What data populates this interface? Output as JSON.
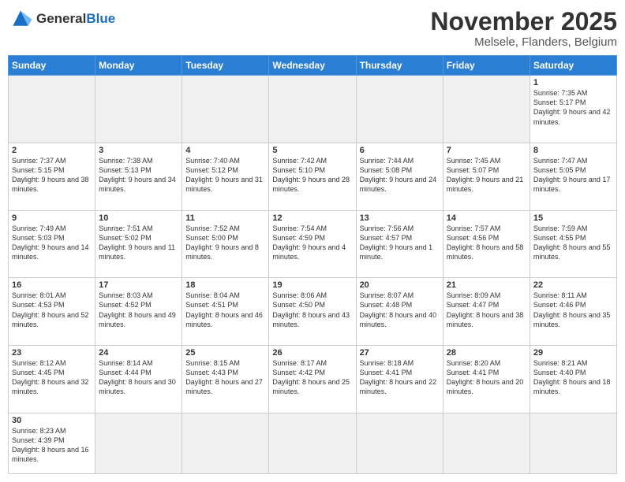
{
  "header": {
    "logo_general": "General",
    "logo_blue": "Blue",
    "month_title": "November 2025",
    "location": "Melsele, Flanders, Belgium"
  },
  "days_of_week": [
    "Sunday",
    "Monday",
    "Tuesday",
    "Wednesday",
    "Thursday",
    "Friday",
    "Saturday"
  ],
  "weeks": [
    [
      {
        "day": "",
        "info": ""
      },
      {
        "day": "",
        "info": ""
      },
      {
        "day": "",
        "info": ""
      },
      {
        "day": "",
        "info": ""
      },
      {
        "day": "",
        "info": ""
      },
      {
        "day": "",
        "info": ""
      },
      {
        "day": "1",
        "info": "Sunrise: 7:35 AM\nSunset: 5:17 PM\nDaylight: 9 hours and 42 minutes."
      }
    ],
    [
      {
        "day": "2",
        "info": "Sunrise: 7:37 AM\nSunset: 5:15 PM\nDaylight: 9 hours and 38 minutes."
      },
      {
        "day": "3",
        "info": "Sunrise: 7:38 AM\nSunset: 5:13 PM\nDaylight: 9 hours and 34 minutes."
      },
      {
        "day": "4",
        "info": "Sunrise: 7:40 AM\nSunset: 5:12 PM\nDaylight: 9 hours and 31 minutes."
      },
      {
        "day": "5",
        "info": "Sunrise: 7:42 AM\nSunset: 5:10 PM\nDaylight: 9 hours and 28 minutes."
      },
      {
        "day": "6",
        "info": "Sunrise: 7:44 AM\nSunset: 5:08 PM\nDaylight: 9 hours and 24 minutes."
      },
      {
        "day": "7",
        "info": "Sunrise: 7:45 AM\nSunset: 5:07 PM\nDaylight: 9 hours and 21 minutes."
      },
      {
        "day": "8",
        "info": "Sunrise: 7:47 AM\nSunset: 5:05 PM\nDaylight: 9 hours and 17 minutes."
      }
    ],
    [
      {
        "day": "9",
        "info": "Sunrise: 7:49 AM\nSunset: 5:03 PM\nDaylight: 9 hours and 14 minutes."
      },
      {
        "day": "10",
        "info": "Sunrise: 7:51 AM\nSunset: 5:02 PM\nDaylight: 9 hours and 11 minutes."
      },
      {
        "day": "11",
        "info": "Sunrise: 7:52 AM\nSunset: 5:00 PM\nDaylight: 9 hours and 8 minutes."
      },
      {
        "day": "12",
        "info": "Sunrise: 7:54 AM\nSunset: 4:59 PM\nDaylight: 9 hours and 4 minutes."
      },
      {
        "day": "13",
        "info": "Sunrise: 7:56 AM\nSunset: 4:57 PM\nDaylight: 9 hours and 1 minute."
      },
      {
        "day": "14",
        "info": "Sunrise: 7:57 AM\nSunset: 4:56 PM\nDaylight: 8 hours and 58 minutes."
      },
      {
        "day": "15",
        "info": "Sunrise: 7:59 AM\nSunset: 4:55 PM\nDaylight: 8 hours and 55 minutes."
      }
    ],
    [
      {
        "day": "16",
        "info": "Sunrise: 8:01 AM\nSunset: 4:53 PM\nDaylight: 8 hours and 52 minutes."
      },
      {
        "day": "17",
        "info": "Sunrise: 8:03 AM\nSunset: 4:52 PM\nDaylight: 8 hours and 49 minutes."
      },
      {
        "day": "18",
        "info": "Sunrise: 8:04 AM\nSunset: 4:51 PM\nDaylight: 8 hours and 46 minutes."
      },
      {
        "day": "19",
        "info": "Sunrise: 8:06 AM\nSunset: 4:50 PM\nDaylight: 8 hours and 43 minutes."
      },
      {
        "day": "20",
        "info": "Sunrise: 8:07 AM\nSunset: 4:48 PM\nDaylight: 8 hours and 40 minutes."
      },
      {
        "day": "21",
        "info": "Sunrise: 8:09 AM\nSunset: 4:47 PM\nDaylight: 8 hours and 38 minutes."
      },
      {
        "day": "22",
        "info": "Sunrise: 8:11 AM\nSunset: 4:46 PM\nDaylight: 8 hours and 35 minutes."
      }
    ],
    [
      {
        "day": "23",
        "info": "Sunrise: 8:12 AM\nSunset: 4:45 PM\nDaylight: 8 hours and 32 minutes."
      },
      {
        "day": "24",
        "info": "Sunrise: 8:14 AM\nSunset: 4:44 PM\nDaylight: 8 hours and 30 minutes."
      },
      {
        "day": "25",
        "info": "Sunrise: 8:15 AM\nSunset: 4:43 PM\nDaylight: 8 hours and 27 minutes."
      },
      {
        "day": "26",
        "info": "Sunrise: 8:17 AM\nSunset: 4:42 PM\nDaylight: 8 hours and 25 minutes."
      },
      {
        "day": "27",
        "info": "Sunrise: 8:18 AM\nSunset: 4:41 PM\nDaylight: 8 hours and 22 minutes."
      },
      {
        "day": "28",
        "info": "Sunrise: 8:20 AM\nSunset: 4:41 PM\nDaylight: 8 hours and 20 minutes."
      },
      {
        "day": "29",
        "info": "Sunrise: 8:21 AM\nSunset: 4:40 PM\nDaylight: 8 hours and 18 minutes."
      }
    ],
    [
      {
        "day": "30",
        "info": "Sunrise: 8:23 AM\nSunset: 4:39 PM\nDaylight: 8 hours and 16 minutes."
      },
      {
        "day": "",
        "info": ""
      },
      {
        "day": "",
        "info": ""
      },
      {
        "day": "",
        "info": ""
      },
      {
        "day": "",
        "info": ""
      },
      {
        "day": "",
        "info": ""
      },
      {
        "day": "",
        "info": ""
      }
    ]
  ]
}
